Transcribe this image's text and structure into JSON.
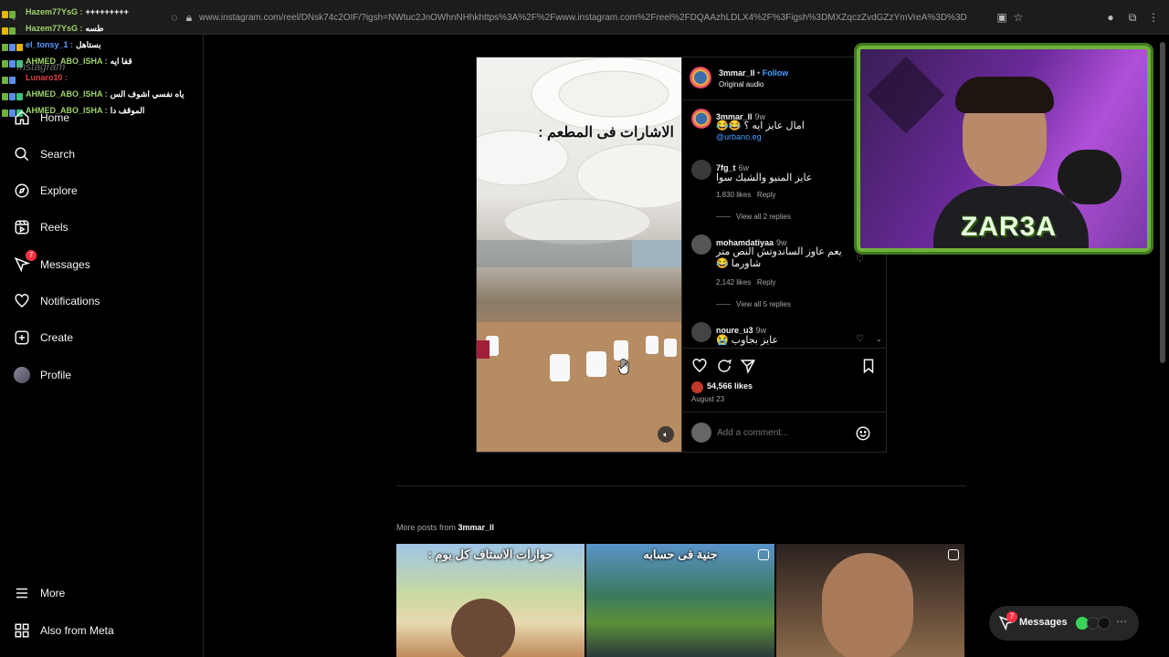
{
  "browser": {
    "url": "www.instagram.com/reel/DNsk74c2OIF/?igsh=NWtuc2JnOWhnNHhkhttps%3A%2F%2Fwww.instagram.com%2Freel%2FDQAAzhLDLX4%2F%3Figsh%3DMXZqczZvdGZzYmVreA%3D%3D"
  },
  "chat": {
    "lines": [
      {
        "user": "Hazem77YsG :",
        "msg": "+++++++++"
      },
      {
        "user": "Hazem77YsG :",
        "msg": "طسه"
      },
      {
        "user": "el_tonsy_1 :",
        "msg": "بستاهل"
      },
      {
        "user": "AHMED_ABO_ISHA :",
        "msg": "قفا ايه"
      },
      {
        "user": "Lunaro10 :",
        "msg": ""
      },
      {
        "user": "AHMED_ABO_ISHA :",
        "msg": "ياه نفسي اشوف الس"
      },
      {
        "user": "AHMED_ABO_ISHA :",
        "msg": "الموقف دا"
      }
    ],
    "ghost": "Instagram"
  },
  "sidebar": {
    "items": [
      {
        "label": "Home",
        "icon": "home-icon"
      },
      {
        "label": "Search",
        "icon": "search-icon"
      },
      {
        "label": "Explore",
        "icon": "compass-icon"
      },
      {
        "label": "Reels",
        "icon": "reels-icon"
      },
      {
        "label": "Messages",
        "icon": "messenger-icon",
        "badge": "7"
      },
      {
        "label": "Notifications",
        "icon": "heart-icon"
      },
      {
        "label": "Create",
        "icon": "plus-square-icon"
      },
      {
        "label": "Profile",
        "icon": "profile-avatar"
      }
    ],
    "more": "More",
    "meta": "Also from Meta"
  },
  "post": {
    "overlay_text": "الاشارات فى المطعم :",
    "author": "3mmar_ll",
    "follow": "Follow",
    "audio": "Original audio",
    "caption_user": "3mmar_ll",
    "caption_time": "9w",
    "caption_text": "امال عايز ايه ؟ 😂😂",
    "caption_link": "@urbano.eg",
    "comments": [
      {
        "user": "7fg_t",
        "time": "6w",
        "text": "عايز المنيو والشيك سوا",
        "likes": "1,830 likes",
        "reply": "Reply",
        "view": "View all 2 replies"
      },
      {
        "user": "mohamdatiyaa",
        "time": "9w",
        "text": "يعم عاوز الساندوتش النص متر شاورما 😂",
        "likes": "2,142 likes",
        "reply": "Reply",
        "view": "View all 5 replies"
      },
      {
        "user": "noure_u3",
        "time": "9w",
        "text": "عايز بجاوب 😭"
      }
    ],
    "likes": "54,566 likes",
    "date": "August 23",
    "add_comment": "Add a comment..."
  },
  "more_posts": {
    "prefix": "More posts from ",
    "user": "3mmar_ll",
    "thumbs": [
      {
        "text": "حوارات الاستاف كل يوم :"
      },
      {
        "text": "جنية فى حسابه"
      },
      {
        "text": ""
      }
    ]
  },
  "webcam": {
    "logo": "ZAR3A"
  },
  "bottom_messages": {
    "label": "Messages",
    "badge": "7"
  },
  "colors": {
    "accent": "#0095f6",
    "badge": "#ff3040",
    "webcam_frame": "#6fb33a"
  }
}
